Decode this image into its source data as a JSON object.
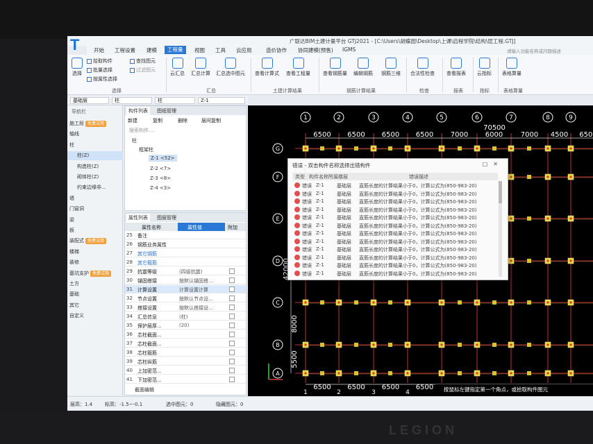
{
  "window_title": "广联达BIM土建计量平台 GTJ2021 - [C:\\Users\\胡蝶园\\Desktop\\上课\\启程学院\\结构\\层工程.GTJ]",
  "menu": [
    "开始",
    "工程设置",
    "建模",
    "工程量",
    "视图",
    "工具",
    "云应用",
    "造价协作",
    "协同建模(预售)",
    "IGMS"
  ],
  "search_hint": "请输入功能名称或问题描述",
  "ribbon": {
    "select_label": "选择",
    "pick_component": "拾取构件",
    "batch_select": "批量选择",
    "select_by_attr": "按属性选择",
    "find_shape": "查找图元",
    "filter_shape": "过滤图元",
    "group_select": "选择",
    "cloud_sum": "云汇总",
    "sum_calc": "汇总计算",
    "sum_selected": "汇总选中图元",
    "group_sum": "汇总",
    "view_calc": "查看计算式",
    "view_quantity": "查看工程量",
    "group_civil": "土建计算结果",
    "view_rebar": "查看钢筋量",
    "edit_rebar": "编辑钢筋",
    "rebar_3d": "钢筋三维",
    "group_rebar": "钢筋计算结果",
    "legality": "合法性检查",
    "group_check": "检查",
    "view_report": "查看报表",
    "group_report": "报表",
    "cloud_index": "云指标",
    "group_index": "指标",
    "table_quantity": "表格算量",
    "group_table": "表格算量"
  },
  "selectors": {
    "floor": "基础层",
    "type": "柱",
    "sub_type": "柱",
    "component": "Z-1"
  },
  "nav": {
    "title": "导航栏",
    "items": [
      {
        "label": "施工段",
        "badge": "免费试用"
      },
      {
        "label": "轴线",
        "badge": ""
      },
      {
        "label": "柱",
        "badge": ""
      },
      {
        "label": "柱(Z)",
        "badge": ""
      },
      {
        "label": "构造柱(Z)",
        "badge": ""
      },
      {
        "label": "砌体柱(Z)",
        "badge": ""
      },
      {
        "label": "约束边缘非...",
        "badge": ""
      },
      {
        "label": "墙",
        "badge": ""
      },
      {
        "label": "门窗洞",
        "badge": ""
      },
      {
        "label": "梁",
        "badge": ""
      },
      {
        "label": "板",
        "badge": ""
      },
      {
        "label": "装配式",
        "badge": "免费试用"
      },
      {
        "label": "楼梯",
        "badge": ""
      },
      {
        "label": "装修",
        "badge": ""
      },
      {
        "label": "基坑支护",
        "badge": "免费试用"
      },
      {
        "label": "土方",
        "badge": ""
      },
      {
        "label": "基础",
        "badge": ""
      },
      {
        "label": "其它",
        "badge": ""
      },
      {
        "label": "自定义",
        "badge": ""
      }
    ]
  },
  "component_list": {
    "tabs": [
      "构件列表",
      "图纸管理"
    ],
    "toolbar": [
      "新建",
      "复制",
      "删除",
      "层间复制"
    ],
    "search": "搜索构件...",
    "tree": [
      "柱",
      "框架柱",
      "Z-1 <52>",
      "Z-2 <7>",
      "Z-3 <8>",
      "Z-4 <3>"
    ]
  },
  "properties": {
    "tabs": [
      "属性列表",
      "图层管理"
    ],
    "headers": [
      "属性名称",
      "属性值",
      "附加"
    ],
    "rows": [
      {
        "n": "25",
        "name": "备注",
        "value": ""
      },
      {
        "n": "26",
        "name": "钢筋业务属性",
        "value": ""
      },
      {
        "n": "27",
        "name": "其它钢筋",
        "value": ""
      },
      {
        "n": "28",
        "name": "其它箍筋",
        "value": ""
      },
      {
        "n": "29",
        "name": "抗震等级",
        "value": "(四级抗震)"
      },
      {
        "n": "30",
        "name": "锚固搭接",
        "value": "按默认锚固搭..."
      },
      {
        "n": "31",
        "name": "计算设置",
        "value": "计算设置计算"
      },
      {
        "n": "32",
        "name": "节点设置",
        "value": "按默认节点设..."
      },
      {
        "n": "33",
        "name": "搭接设置",
        "value": "按默认搭接设..."
      },
      {
        "n": "34",
        "name": "汇总信息",
        "value": "(柱)"
      },
      {
        "n": "35",
        "name": "保护层厚...",
        "value": "(20)"
      },
      {
        "n": "36",
        "name": "芯柱截面...",
        "value": ""
      },
      {
        "n": "37",
        "name": "芯柱截面...",
        "value": ""
      },
      {
        "n": "38",
        "name": "芯柱箍筋",
        "value": ""
      },
      {
        "n": "39",
        "name": "芯柱纵筋",
        "value": ""
      },
      {
        "n": "40",
        "name": "上加密范...",
        "value": ""
      },
      {
        "n": "41",
        "name": "下加密范...",
        "value": ""
      }
    ],
    "footer": "截面编辑"
  },
  "axes": {
    "top": [
      "1",
      "2",
      "3",
      "4",
      "5",
      "6",
      "7",
      "8",
      "9"
    ],
    "left": [
      "G",
      "F",
      "E",
      "D",
      "C",
      "B",
      "A"
    ],
    "top_dims": [
      "6500",
      "6500",
      "6500",
      "6500",
      "7000",
      "6000",
      "7000",
      "4500",
      "6500"
    ],
    "total": "70500",
    "left_dims": [
      "8000",
      "5500"
    ],
    "vertical_total": "42000"
  },
  "dialog": {
    "title": "错误 - 双击构件名称选择出错构件",
    "headers": [
      "类型",
      "构件名称",
      "所属楼层",
      "错误描述"
    ],
    "rows": [
      {
        "type": "错误",
        "name": "Z-1",
        "floor": "基础层",
        "desc": "直筋长度的计算结果小于0，计算公式为(850-983-20)"
      },
      {
        "type": "错误",
        "name": "Z-1",
        "floor": "基础层",
        "desc": "直筋长度的计算结果小于0，计算公式为(850-983-20)"
      },
      {
        "type": "错误",
        "name": "Z-1",
        "floor": "基础层",
        "desc": "直筋长度的计算结果小于0，计算公式为(850-983-20)"
      },
      {
        "type": "错误",
        "name": "Z-1",
        "floor": "基础层",
        "desc": "直筋长度的计算结果小于0，计算公式为(850-983-20)"
      },
      {
        "type": "错误",
        "name": "Z-1",
        "floor": "基础层",
        "desc": "直筋长度的计算结果小于0，计算公式为(850-983-20)"
      },
      {
        "type": "错误",
        "name": "Z-1",
        "floor": "基础层",
        "desc": "直筋长度的计算结果小于0，计算公式为(850-983-20)"
      },
      {
        "type": "错误",
        "name": "Z-1",
        "floor": "基础层",
        "desc": "直筋长度的计算结果小于0，计算公式为(850-983-20)"
      },
      {
        "type": "错误",
        "name": "Z-1",
        "floor": "基础层",
        "desc": "直筋长度的计算结果小于0，计算公式为(850-983-20)"
      },
      {
        "type": "错误",
        "name": "Z-1",
        "floor": "基础层",
        "desc": "直筋长度的计算结果小于0，计算公式为(850-983-20)"
      },
      {
        "type": "错误",
        "name": "Z-1",
        "floor": "基础层",
        "desc": "直筋长度的计算结果小于0，计算公式为(850-983-20)"
      },
      {
        "type": "错误",
        "name": "Z-1",
        "floor": "基础层",
        "desc": "直筋长度的计算结果小于0，计算公式为(850-983-20)"
      },
      {
        "type": "错误",
        "name": "Z-1",
        "floor": "基础层",
        "desc": "直筋长度的计算结果小于0，计算公式为(850-983-20)"
      }
    ]
  },
  "canvas_hint": "按鼠标左键指定第一个角点，或拾取构件图元",
  "status": {
    "floor_height": "层高：1.4",
    "elevation": "标高：-1.5~-0.1",
    "selected": "选中图元：0",
    "hidden": "隐藏图元：0"
  }
}
